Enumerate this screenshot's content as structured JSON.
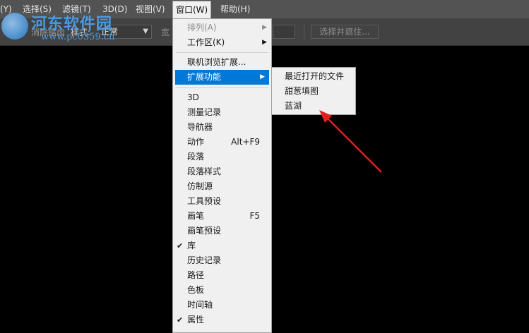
{
  "menubar": {
    "items": [
      "(Y)",
      "选择(S)",
      "滤镜(T)",
      "3D(D)",
      "视图(V)",
      "窗口(W)",
      "帮助(H)"
    ],
    "active": "窗口(W)"
  },
  "optbar": {
    "feather_label": "消除锯齿",
    "style_label": "样式:",
    "style_value": "正常",
    "width_label": "宽",
    "mask_button": "选择并遮住..."
  },
  "watermark": {
    "text": "河东软件园",
    "url": "www.pc0359.cn"
  },
  "window_menu": {
    "items": [
      {
        "label": "排列(A)",
        "disabled": true,
        "submenu": true
      },
      {
        "label": "工作区(K)",
        "submenu": true
      },
      {
        "label": "联机浏览扩展..."
      },
      {
        "label": "扩展功能",
        "submenu": true,
        "highlighted": true
      },
      {
        "label": "3D"
      },
      {
        "label": "测量记录"
      },
      {
        "label": "导航器"
      },
      {
        "label": "动作",
        "shortcut": "Alt+F9"
      },
      {
        "label": "段落"
      },
      {
        "label": "段落样式"
      },
      {
        "label": "仿制源"
      },
      {
        "label": "工具预设"
      },
      {
        "label": "画笔",
        "shortcut": "F5"
      },
      {
        "label": "画笔预设"
      },
      {
        "label": "库",
        "checked": true
      },
      {
        "label": "历史记录"
      },
      {
        "label": "路径"
      },
      {
        "label": "色板"
      },
      {
        "label": "时间轴"
      },
      {
        "label": "属性",
        "checked": true
      }
    ]
  },
  "extensions_submenu": {
    "items": [
      "最近打开的文件",
      "甜葱填图",
      "蓝湖"
    ]
  },
  "colors": {
    "menubar": "#535353",
    "highlight": "#0078d7",
    "annotation_arrow": "#e02020"
  },
  "icons": {
    "submenu_arrow": "caret-right-icon",
    "check": "checkmark-icon"
  }
}
